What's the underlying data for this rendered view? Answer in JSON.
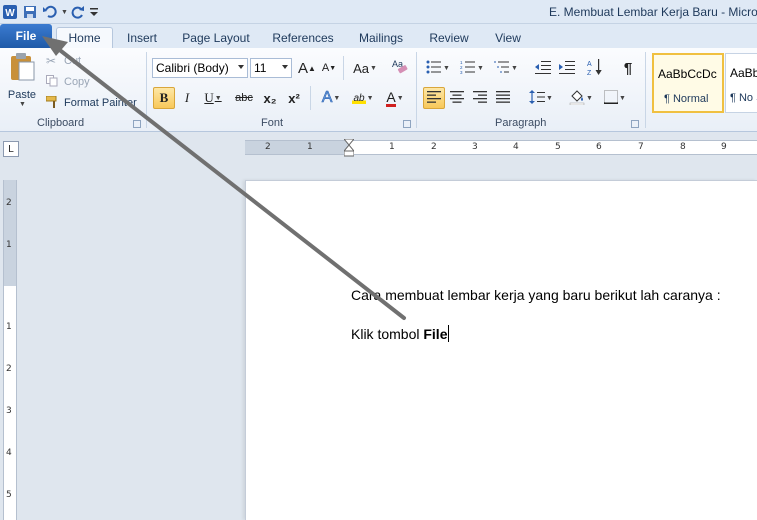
{
  "window": {
    "title": "E. Membuat Lembar Kerja Baru - Micro"
  },
  "tabs": {
    "file": "File",
    "items": [
      "Home",
      "Insert",
      "Page Layout",
      "References",
      "Mailings",
      "Review",
      "View"
    ],
    "active": "Home"
  },
  "ribbon": {
    "clipboard": {
      "label": "Clipboard",
      "paste": "Paste",
      "cut": "Cut",
      "copy": "Copy",
      "format_painter": "Format Painter"
    },
    "font": {
      "label": "Font",
      "font_name": "Calibri (Body)",
      "font_size": "11",
      "grow": "A",
      "shrink": "A",
      "change_case": "Aa",
      "bold": "B",
      "italic": "I",
      "underline": "U",
      "strike": "abc",
      "subscript": "x₂",
      "superscript": "x²",
      "text_effects": "A",
      "highlight": "ab",
      "font_color": "A"
    },
    "paragraph": {
      "label": "Paragraph",
      "pilcrow": "¶"
    },
    "styles": {
      "normal_sample": "AaBbCcDc",
      "normal_name": "¶ Normal",
      "nospacing_sample": "AaBbCcDc",
      "nospacing_name": "¶ No Spacing"
    }
  },
  "ruler": {
    "corner": "L",
    "h_ticks": [
      "2",
      "1",
      "1",
      "2",
      "3",
      "4",
      "5",
      "6",
      "7",
      "8",
      "9"
    ],
    "v_ticks": [
      "2",
      "1",
      "1",
      "2",
      "3",
      "4",
      "5"
    ]
  },
  "document": {
    "line1": "Cara membuat lembar kerja yang baru berikut lah caranya :",
    "line2_prefix": "Klik tombol ",
    "line2_bold": "File"
  },
  "colors": {
    "file_tab": "#2b6cc4",
    "arrow": "#707070",
    "highlight_yellow": "#f8c85a",
    "font_color_red": "#d02020"
  }
}
